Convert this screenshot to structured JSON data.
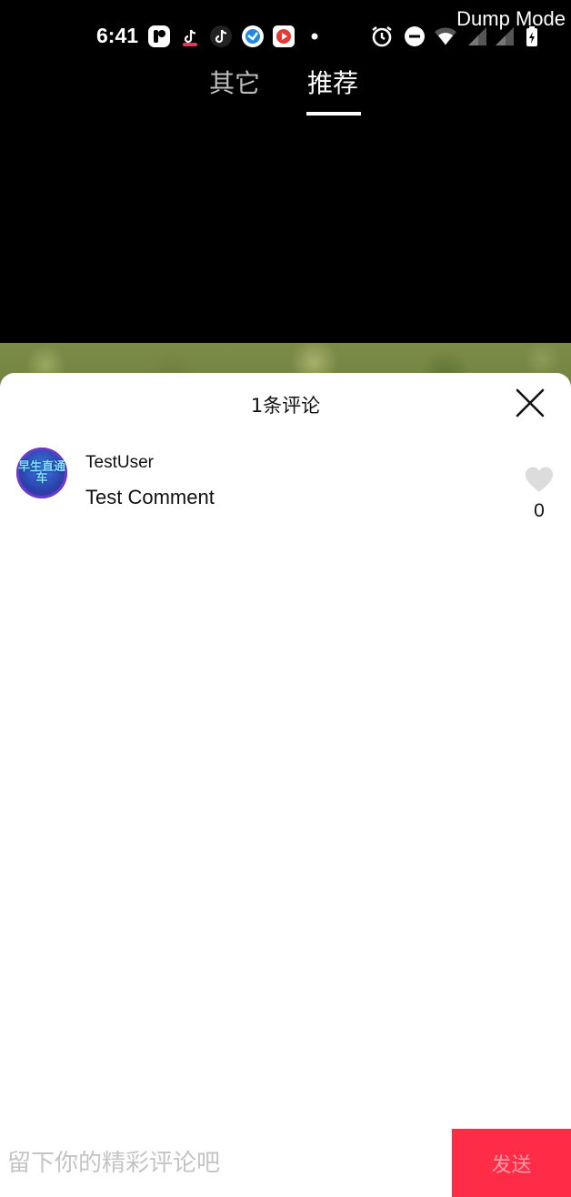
{
  "status_bar": {
    "time": "6:41",
    "overlay_label": "Dump Mode",
    "icons": [
      "notification-app-icon",
      "tiktok-icon",
      "tiktok-icon",
      "browser-icon",
      "video-app-icon",
      "dot-icon",
      "alarm-icon",
      "do-not-disturb-icon",
      "wifi-icon",
      "signal-icon",
      "signal-icon",
      "battery-icon"
    ]
  },
  "tabs": [
    {
      "label": "其它",
      "active": false
    },
    {
      "label": "推荐",
      "active": true
    }
  ],
  "comments_panel": {
    "title": "1条评论",
    "close_icon": "close-icon",
    "comments": [
      {
        "username": "TestUser",
        "text": "Test Comment",
        "avatar_text": "早生直通车",
        "likes": "0",
        "like_icon": "heart-icon"
      }
    ]
  },
  "composer": {
    "placeholder": "留下你的精彩评论吧",
    "value": "",
    "send_label": "发送"
  },
  "colors": {
    "accent": "#fe2c46",
    "send_text": "#ff9aa6",
    "placeholder": "#c4c4c4",
    "like_icon": "#dcdcdc",
    "inactive_tab": "#bdbdbd"
  }
}
